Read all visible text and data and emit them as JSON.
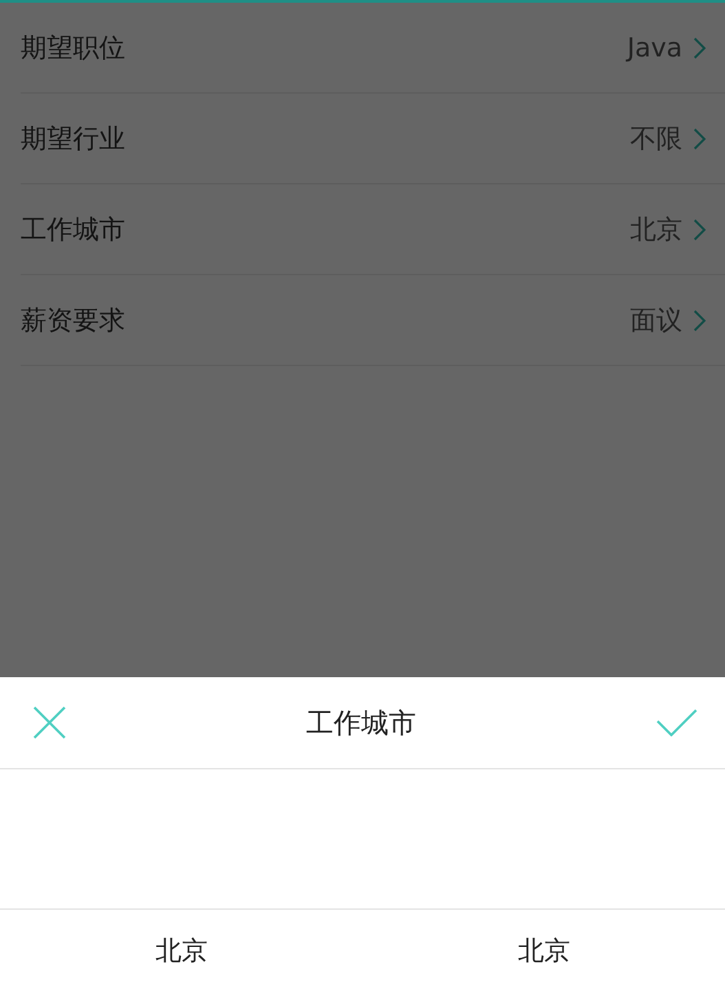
{
  "settings": [
    {
      "label": "期望职位",
      "value": "Java"
    },
    {
      "label": "期望行业",
      "value": "不限"
    },
    {
      "label": "工作城市",
      "value": "北京"
    },
    {
      "label": "薪资要求",
      "value": "面议"
    }
  ],
  "picker": {
    "title": "工作城市",
    "columns": [
      {
        "value": "北京"
      },
      {
        "value": "北京"
      }
    ]
  }
}
